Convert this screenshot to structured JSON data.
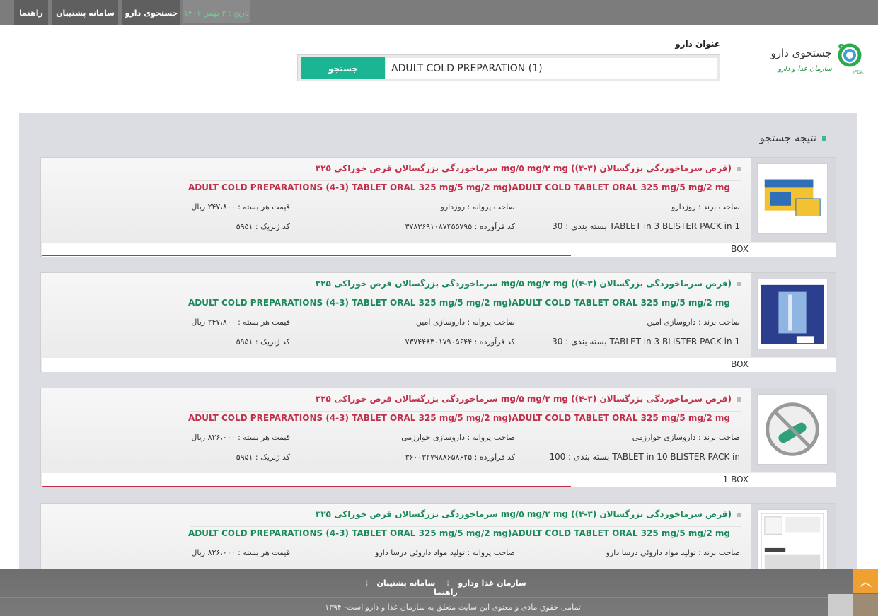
{
  "topnav": {
    "help": "راهنما",
    "support": "سامانه پشتیبان",
    "drug_search": "جستجوی دارو",
    "date": "تاریخ : ۳ بهمن ۱۴۰۱"
  },
  "logo": {
    "title": "جستجوی دارو",
    "subtitle": "سازمان غذا و دارو"
  },
  "search": {
    "label": "عنوان دارو",
    "value": "ADULT COLD PREPARATION (1)",
    "button": "جستجو"
  },
  "results_title": "نتیجه جستجو",
  "results": [
    {
      "fa_title": "سرماخوردگی بزرگسالان قرص خوراکی ۳۲۵ mg/۵ mg/۲ mg (قرص سرماخوردگی بزرگسالان (۳-۴))",
      "en_title": "ADULT COLD PREPARATIONS (4-3) TABLET ORAL 325 mg/5 mg/2 mg)ADULT COLD TABLET ORAL 325 mg/5 mg/2 mg",
      "brand": "صاحب برند : روزدارو",
      "license": "صاحب پروانه : روزدارو",
      "price": "قیمت هر بسته : ۲۴۷،۸۰۰ ریال",
      "packaging": "بسته بندی : 30 TABLET in 3 BLISTER PACK in 1",
      "product_code": "کد فرآورده : ۳۷۸۳۶۹۱۰۸۷۴۵۵۷۹۵",
      "generic_code": "کد ژنریک : ۵۹۵۱",
      "box": "BOX",
      "color": "red"
    },
    {
      "fa_title": "سرماخوردگی بزرگسالان قرص خوراکی ۳۲۵ mg/۵ mg/۲ mg (قرص سرماخوردگی بزرگسالان (۳-۴))",
      "en_title": "ADULT COLD PREPARATIONS (4-3) TABLET ORAL 325 mg/5 mg/2 mg)ADULT COLD TABLET ORAL 325 mg/5 mg/2 mg",
      "brand": "صاحب برند : داروسازی امین",
      "license": "صاحب پروانه : داروسازی امین",
      "price": "قیمت هر بسته : ۲۴۷،۸۰۰ ریال",
      "packaging": "بسته بندی : 30 TABLET in 3 BLISTER PACK in 1",
      "product_code": "کد فرآورده : ۷۳۷۴۴۸۳۰۱۷۹۰۵۶۴۴",
      "generic_code": "کد ژنریک : ۵۹۵۱",
      "box": "BOX",
      "color": "green"
    },
    {
      "fa_title": "سرماخوردگی بزرگسالان قرص خوراکی ۳۲۵ mg/۵ mg/۲ mg (قرص سرماخوردگی بزرگسالان (۳-۴))",
      "en_title": "ADULT COLD PREPARATIONS (4-3) TABLET ORAL 325 mg/5 mg/2 mg)ADULT COLD TABLET ORAL 325 mg/5 mg/2 mg",
      "brand": "صاحب برند : داروسازی خوارزمی",
      "license": "صاحب پروانه : داروسازی خوارزمی",
      "price": "قیمت هر بسته : ۸۲۶،۰۰۰ ریال",
      "packaging": "بسته بندی : 100 TABLET in 10 BLISTER PACK in",
      "product_code": "کد فرآورده : ۳۶۰۰۳۲۷۹۸۸۶۵۸۶۲۵",
      "generic_code": "کد ژنریک : ۵۹۵۱",
      "box": "1 BOX",
      "color": "red"
    },
    {
      "fa_title": "سرماخوردگی بزرگسالان قرص خوراکی ۳۲۵ mg/۵ mg/۲ mg (قرص سرماخوردگی بزرگسالان (۳-۴))",
      "en_title": "ADULT COLD PREPARATIONS (4-3) TABLET ORAL 325 mg/5 mg/2 mg)ADULT COLD TABLET ORAL 325 mg/5 mg/2 mg",
      "brand": "صاحب برند : تولید مواد داروئی درسا دارو",
      "license": "صاحب پروانه : تولید مواد داروئی درسا دارو",
      "price": "قیمت هر بسته : ۸۲۶،۰۰۰ ریال",
      "packaging": "",
      "product_code": "",
      "generic_code": "",
      "box": "",
      "color": "green"
    }
  ],
  "footer": {
    "links": [
      "سازمان غذا ودارو",
      "سامانه پشتیبان",
      "راهنما"
    ],
    "copyright": "تمامی حقوق مادی و معنوی این سایت متعلق به سازمان غذا و دارو است- ۱۳۹۴"
  },
  "colors": {
    "accent": "#1cb593",
    "red_title": "#c0304a",
    "green_title": "#1a8a5b"
  }
}
